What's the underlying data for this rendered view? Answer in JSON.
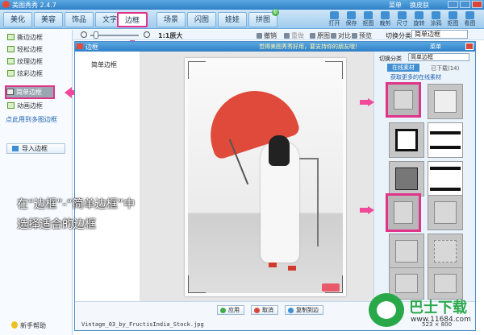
{
  "app": {
    "title": "美图秀秀 2.4.7",
    "menu_a": "菜单",
    "menu_b": "换皮肤"
  },
  "tabs": [
    {
      "label": "美化"
    },
    {
      "label": "美容"
    },
    {
      "label": "饰品"
    },
    {
      "label": "文字"
    },
    {
      "label": "边框",
      "active": true
    },
    {
      "label": "场景"
    },
    {
      "label": "闪图"
    },
    {
      "label": "娃娃"
    },
    {
      "label": "拼图",
      "badge": "新"
    }
  ],
  "tools": [
    {
      "label": "打开",
      "icon": "folder-icon"
    },
    {
      "label": "保存",
      "icon": "save-icon"
    },
    {
      "label": "抠图",
      "icon": "cutout-icon"
    },
    {
      "label": "裁剪",
      "icon": "crop-icon"
    },
    {
      "label": "尺寸",
      "icon": "resize-icon"
    },
    {
      "label": "旋转",
      "icon": "rotate-icon"
    },
    {
      "label": "涂鸦",
      "icon": "brush-icon"
    },
    {
      "label": "抠图",
      "icon": "cutout2-icon"
    },
    {
      "label": "看图",
      "icon": "view-icon"
    }
  ],
  "sidebar": {
    "items": [
      {
        "label": "撕边边框"
      },
      {
        "label": "轻松边框"
      },
      {
        "label": "纹理边框"
      },
      {
        "label": "炫彩边框"
      },
      {
        "label": "简单边框",
        "selected": true
      },
      {
        "label": "动画边框"
      }
    ],
    "link": "点此用到多图边框",
    "import_label": "导入边框",
    "help_label": "新手帮助"
  },
  "subtoolbar": {
    "zoom_text": "1:1原大",
    "undo": "撤销",
    "redo": "重做",
    "original": "原图",
    "compare": "对比",
    "preview": "预览",
    "category_label": "切换分类",
    "category_value": "简单边框"
  },
  "editor": {
    "title": "边框",
    "promo": "觉得美图秀秀好用，要支持你的朋友哦！",
    "menu": "菜单",
    "left_label": "简单边框",
    "right": {
      "category_label": "切换分类",
      "category_value": "简单边框",
      "tab_online": "在线素材",
      "downloaded": "已下载(14)",
      "get_more": "获取更多的在线素材"
    },
    "buttons": {
      "apply": "应用",
      "cancel": "取消",
      "copy": "复制到边"
    },
    "filename": "Vintage_03_by_FructisIndia_Stock.jpg",
    "dimensions": "523 × 800"
  },
  "annotation": {
    "line1": "在“边框”-“简单边框”中",
    "line2": "选择适合的边框"
  },
  "watermark": {
    "name": "巴士下载",
    "url": "www.11684.com"
  },
  "colors": {
    "highlight": "#e0338a",
    "accent": "#3f8fd2",
    "title_bar": "#2f80c8"
  }
}
